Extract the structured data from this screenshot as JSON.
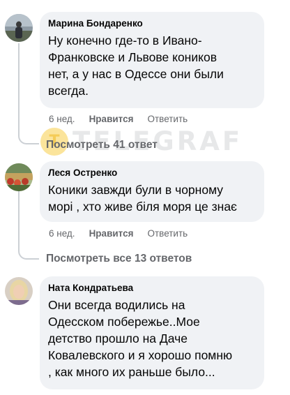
{
  "watermark": {
    "text": "TELEGRAF",
    "badge_letter": "T"
  },
  "comments": [
    {
      "author": "Марина Бондаренко",
      "lines": [
        "Ну конечно где-то в Ивано-",
        "Франковске и Львове коников",
        "нет, а у нас в Одессе они были",
        "всегда."
      ],
      "time": "6 нед.",
      "like_label": "Нравится",
      "reply_label": "Ответить",
      "more_replies": "Посмотреть 41 ответ"
    },
    {
      "author": "Леся Остренко",
      "lines": [
        "Коники завжди були в чорному",
        "морі , хто живе біля моря це знає"
      ],
      "time": "6 нед.",
      "like_label": "Нравится",
      "reply_label": "Ответить",
      "more_replies": "Посмотреть все 13 ответов"
    },
    {
      "author": "Ната Кондратьева",
      "lines": [
        "Они всегда водились на",
        "Одесском побережье..Мое",
        "детство прошло на Даче",
        "Ковалевского и я хорошо помню",
        ", как много их раньше было..."
      ]
    }
  ],
  "colors": {
    "bubble": "#f0f2f5",
    "secondary_text": "#65676b",
    "thread_line": "#ccd0d5"
  },
  "icons": [
    "avatar-photo-marina",
    "avatar-photo-lesya",
    "avatar-photo-nata"
  ]
}
